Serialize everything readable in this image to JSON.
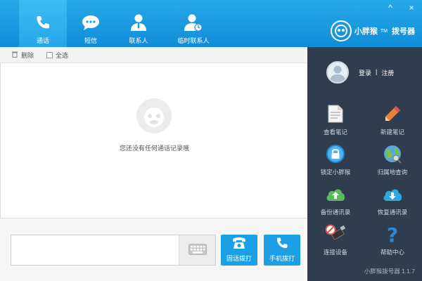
{
  "window": {
    "minimize": "^",
    "close": "×"
  },
  "tabs": [
    {
      "label": "通话",
      "icon": "phone-icon",
      "active": true
    },
    {
      "label": "短信",
      "icon": "sms-icon",
      "active": false
    },
    {
      "label": "联系人",
      "icon": "contact-icon",
      "active": false
    },
    {
      "label": "临时联系人",
      "icon": "temp-contact-icon",
      "active": false
    }
  ],
  "brand": {
    "name": "小胖猴",
    "tm": "TM",
    "sub": "拨号器"
  },
  "toolbar": {
    "delete_label": "删除",
    "select_all_label": "全选"
  },
  "empty": {
    "message": "您还没有任何通话记录哦"
  },
  "dialer": {
    "number_value": "",
    "landline_label": "固话拨打",
    "mobile_label": "手机拨打"
  },
  "user": {
    "login": "登录",
    "separator": "|",
    "register": "注册"
  },
  "side_items": [
    {
      "label": "查看笔记",
      "icon": "notes-icon"
    },
    {
      "label": "新建笔记",
      "icon": "pencil-icon"
    },
    {
      "label": "锁定小胖猴",
      "icon": "lock-icon"
    },
    {
      "label": "归属地查询",
      "icon": "globe-icon"
    },
    {
      "label": "备份通讯录",
      "icon": "upload-cloud-icon"
    },
    {
      "label": "恢复通讯录",
      "icon": "download-cloud-icon"
    },
    {
      "label": "连接设备",
      "icon": "usb-device-icon"
    },
    {
      "label": "帮助中心",
      "icon": "help-icon"
    }
  ],
  "version": "小胖猴拨号器 1.1.7",
  "colors": {
    "header": "#1b9ce2",
    "sidebar": "#2f3d4e",
    "button": "#1ba0e6"
  }
}
